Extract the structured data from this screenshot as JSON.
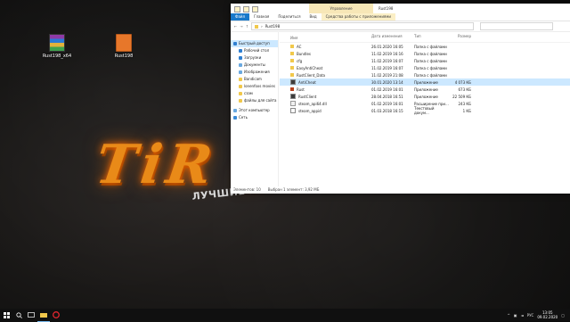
{
  "desktop": {
    "icons": [
      {
        "label": "Rust198_x64"
      },
      {
        "label": "Rust198"
      }
    ],
    "logo_text": "TiR F",
    "tagline": "ЛУЧШИЕ ПИРАТСКИЕ СЕРВЕРА RUST"
  },
  "window": {
    "title": "Rust198",
    "context_group": "Управление",
    "ribbon_tabs": [
      "Файл",
      "Главная",
      "Поделиться",
      "Вид",
      "Средства работы с приложениями"
    ],
    "address": {
      "path": [
        "Rust198"
      ],
      "search_placeholder": ""
    },
    "nav": {
      "quick_access": "Быстрый доступ",
      "items": [
        {
          "label": "Рабочий стол"
        },
        {
          "label": "Загрузки"
        },
        {
          "label": "Документы"
        },
        {
          "label": "Изображения"
        },
        {
          "label": "Bandicam"
        },
        {
          "label": "lonenfoxs movies"
        },
        {
          "label": "сзам"
        },
        {
          "label": "файлы для сайта"
        }
      ],
      "this_pc": "Этот компьютер",
      "network": "Сеть"
    },
    "columns": {
      "name": "Имя",
      "date": "Дата изменения",
      "type": "Тип",
      "size": "Размер"
    },
    "files": [
      {
        "name": "AC",
        "date": "26.01.2020 16:05",
        "type": "Папка с файлами",
        "size": "",
        "icon": "folder"
      },
      {
        "name": "Bundles",
        "date": "11.02.2019 16:16",
        "type": "Папка с файлами",
        "size": "",
        "icon": "folder"
      },
      {
        "name": "cfg",
        "date": "11.02.2019 16:07",
        "type": "Папка с файлами",
        "size": "",
        "icon": "folder"
      },
      {
        "name": "EasyAntiCheat",
        "date": "11.02.2019 16:07",
        "type": "Папка с файлами",
        "size": "",
        "icon": "folder"
      },
      {
        "name": "RustClient_Data",
        "date": "11.02.2019 21:08",
        "type": "Папка с файлами",
        "size": "",
        "icon": "folder"
      },
      {
        "name": "AntiCheat",
        "date": "30.01.2020 13:14",
        "type": "Приложение",
        "size": "4 073 КБ",
        "icon": "app"
      },
      {
        "name": "Rust",
        "date": "01.02.2019 16:01",
        "type": "Приложение",
        "size": "673 КБ",
        "icon": "rust"
      },
      {
        "name": "RustClient",
        "date": "28.04.2018 16:51",
        "type": "Приложение",
        "size": "22 509 КБ",
        "icon": "app"
      },
      {
        "name": "steam_api64.dll",
        "date": "01.02.2019 16:01",
        "type": "Расширение при...",
        "size": "243 КБ",
        "icon": "dll"
      },
      {
        "name": "steam_appid",
        "date": "01.03.2018 16:15",
        "type": "Текстовый докум...",
        "size": "1 КБ",
        "icon": "txt"
      }
    ],
    "selected_index": 5,
    "status": {
      "count": "Элементов: 10",
      "selected": "Выбран 1 элемент: 3,92 МБ"
    }
  },
  "taskbar": {
    "tray_lang": "РУС",
    "time": "13:05",
    "date": "09.02.2020"
  },
  "colors": {
    "accent": "#1979ca",
    "selection": "#cce8ff",
    "logo_orange": "#e98a18"
  }
}
